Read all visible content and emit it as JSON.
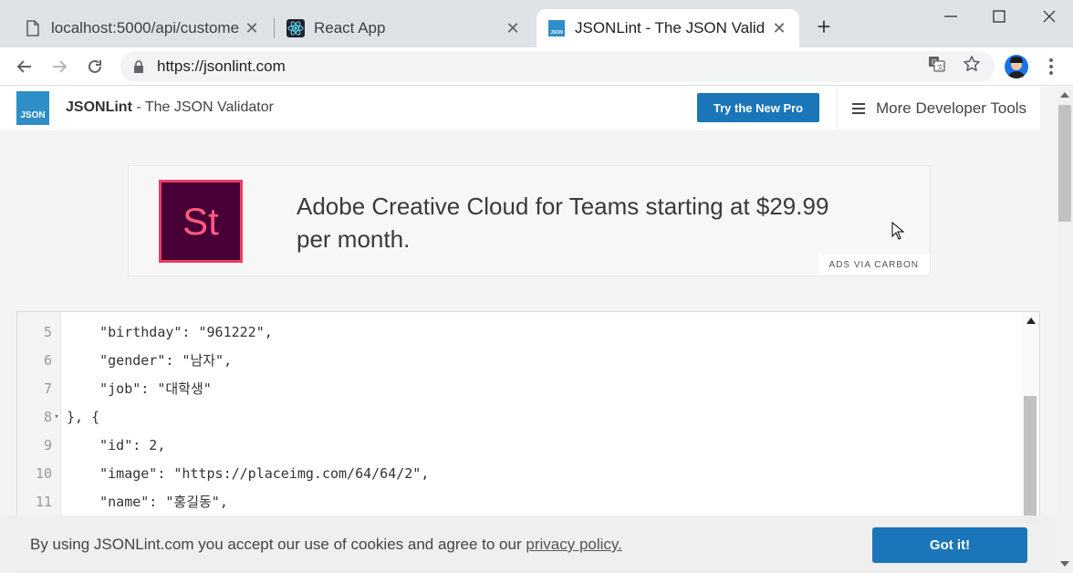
{
  "browser": {
    "tabs": [
      {
        "title": "localhost:5000/api/custome",
        "icon": "page-icon"
      },
      {
        "title": "React App",
        "icon": "react-icon"
      },
      {
        "title": "JSONLint - The JSON Valid",
        "icon": "jsonlint-icon",
        "active": true
      }
    ],
    "new_tab_label": "+",
    "url": "https://jsonlint.com"
  },
  "site": {
    "logo_text": "JSON",
    "brand_name": "JSONLint",
    "brand_tagline": "- The JSON Validator",
    "pro_button": "Try the New Pro",
    "more_tools": "More Developer Tools",
    "accent_color": "#1a76b8"
  },
  "ad": {
    "logo_text": "St",
    "text": "Adobe Creative Cloud for Teams starting at $29.99 per month.",
    "via": "ADS VIA CARBON"
  },
  "editor": {
    "lines": [
      {
        "num": "5",
        "code": "    \"birthday\": \"961222\","
      },
      {
        "num": "6",
        "code": "    \"gender\": \"남자\","
      },
      {
        "num": "7",
        "code": "    \"job\": \"대학생\""
      },
      {
        "num": "8",
        "code": "}, {",
        "fold": "▾"
      },
      {
        "num": "9",
        "code": "    \"id\": 2,"
      },
      {
        "num": "10",
        "code": "    \"image\": \"https://placeimg.com/64/64/2\","
      },
      {
        "num": "11",
        "code": "    \"name\": \"홍길동\","
      }
    ]
  },
  "cookie": {
    "text": "By using JSONLint.com you accept our use of cookies and agree to our",
    "link": "privacy policy.",
    "button": "Got it!"
  }
}
